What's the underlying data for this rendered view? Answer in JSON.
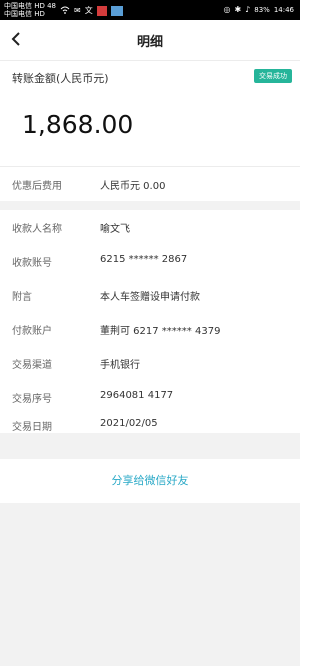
{
  "status_bar": {
    "carrier_line1": "中国电信 HD 48",
    "carrier_line2": "中国电信 HD",
    "battery": "83%",
    "time": "14:46"
  },
  "header": {
    "title": "明细"
  },
  "amount": {
    "label": "转账金额(人民币元)",
    "status": "交易成功",
    "value": "1,868.00"
  },
  "fee": {
    "label": "优惠后费用",
    "value": "人民币元 0.00"
  },
  "details": [
    {
      "label": "收款人名称",
      "value": "喻文飞"
    },
    {
      "label": "收款账号",
      "value": "6215 ****** 2867"
    },
    {
      "label": "附言",
      "value": "本人车签赠设申请付款"
    },
    {
      "label": "付款账户",
      "value": "董荆可 6217 ****** 4379"
    },
    {
      "label": "交易渠道",
      "value": "手机银行"
    },
    {
      "label": "交易序号",
      "value": "2964081 4177"
    },
    {
      "label": "交易日期",
      "value": "2021/02/05"
    }
  ],
  "share_label": "分享给微信好友",
  "colors": {
    "accent": "#2aa9c7",
    "status_green": "#26b59a"
  }
}
